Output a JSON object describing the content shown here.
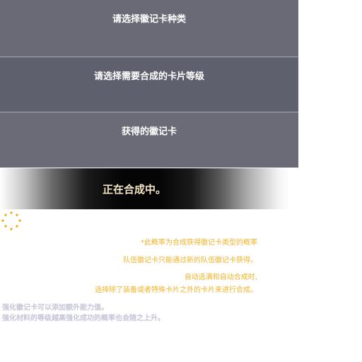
{
  "panels": {
    "badge_type_label": "请选择徽记卡种类",
    "grade_label": "请选择需要合成的卡片等级",
    "result_label": "获得的徽记卡"
  },
  "progress": {
    "text": "正在合成中。"
  },
  "notes": {
    "probability": "*此概率为合成获得徽记卡类型的概率",
    "team_badge": "队伍徽记卡只能通过新的队伍徽记卡获得。",
    "auto_select": "自动选满和自动合成时,",
    "exclusion": "选择除了装备或者特殊卡片之外的卡片来进行合成。"
  },
  "tips": {
    "line1": "强化徽记卡可以添加额外能力值。",
    "line2": "强化材料的等级越高强化成功的概率也会随之上升。"
  },
  "colors": {
    "panel": "#696a75",
    "note": "#f1b327",
    "tip": "#c5c5d6",
    "spinner": "#f2a31c"
  }
}
